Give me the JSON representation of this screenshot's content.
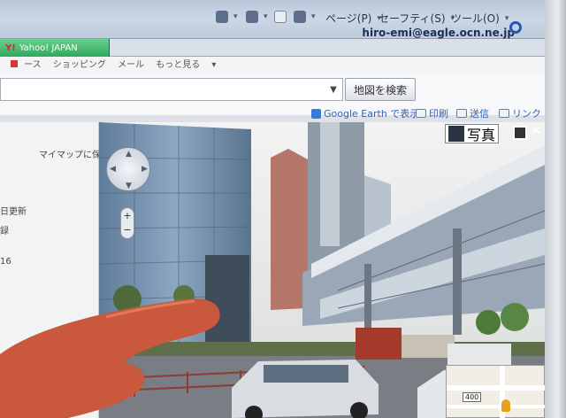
{
  "browser": {
    "tab_label": "Yahoo! JAPAN",
    "menus": [
      "ページ(P)",
      "セーフティ(S)",
      "ツール(O)"
    ],
    "user_email": "hiro-emi@eagle.ocn.ne.jp"
  },
  "nav": {
    "items": [
      "ース",
      "ショッピング",
      "メール",
      "もっと見る"
    ]
  },
  "search": {
    "button_label": "地図を検索"
  },
  "tools": {
    "google_earth": "Google Earth で表示",
    "print": "印刷",
    "send": "送信",
    "link": "リンク"
  },
  "sidebar": {
    "save": "マイマップに保存",
    "updated": "日更新",
    "item2": "録",
    "item3": "16"
  },
  "streetview": {
    "photo_label": "写真",
    "minimap_label": "400"
  },
  "colors": {
    "accent": "#2f62b6",
    "tab_green": "#2ea85c"
  }
}
